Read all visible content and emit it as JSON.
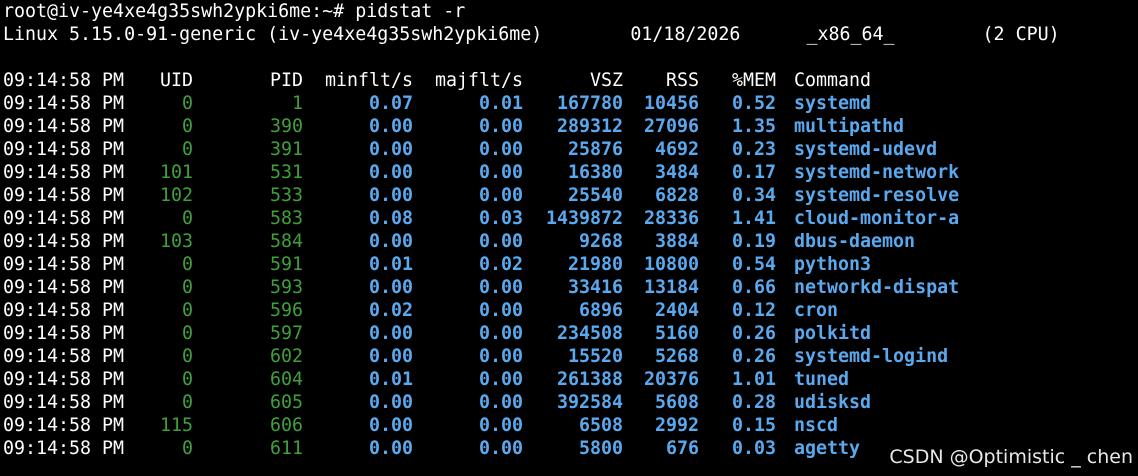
{
  "terminal": {
    "prompt_line": "root@iv-ye4xe4g35swh2ypki6me:~# pidstat -r",
    "info_line": "Linux 5.15.0-91-generic (iv-ye4xe4g35swh2ypki6me)        01/18/2026      _x86_64_        (2 CPU)",
    "headers": {
      "time": "09:14:58 PM",
      "uid": "UID",
      "pid": "PID",
      "minflt": "minflt/s",
      "majflt": "majflt/s",
      "vsz": "VSZ",
      "rss": "RSS",
      "mem": "%MEM",
      "command": "Command"
    },
    "rows": [
      {
        "time": "09:14:58 PM",
        "uid": "0",
        "pid": "1",
        "minflt": "0.07",
        "majflt": "0.01",
        "vsz": "167780",
        "rss": "10456",
        "mem": "0.52",
        "command": "systemd"
      },
      {
        "time": "09:14:58 PM",
        "uid": "0",
        "pid": "390",
        "minflt": "0.00",
        "majflt": "0.00",
        "vsz": "289312",
        "rss": "27096",
        "mem": "1.35",
        "command": "multipathd"
      },
      {
        "time": "09:14:58 PM",
        "uid": "0",
        "pid": "391",
        "minflt": "0.00",
        "majflt": "0.00",
        "vsz": "25876",
        "rss": "4692",
        "mem": "0.23",
        "command": "systemd-udevd"
      },
      {
        "time": "09:14:58 PM",
        "uid": "101",
        "pid": "531",
        "minflt": "0.00",
        "majflt": "0.00",
        "vsz": "16380",
        "rss": "3484",
        "mem": "0.17",
        "command": "systemd-network"
      },
      {
        "time": "09:14:58 PM",
        "uid": "102",
        "pid": "533",
        "minflt": "0.00",
        "majflt": "0.00",
        "vsz": "25540",
        "rss": "6828",
        "mem": "0.34",
        "command": "systemd-resolve"
      },
      {
        "time": "09:14:58 PM",
        "uid": "0",
        "pid": "583",
        "minflt": "0.08",
        "majflt": "0.03",
        "vsz": "1439872",
        "rss": "28336",
        "mem": "1.41",
        "command": "cloud-monitor-a"
      },
      {
        "time": "09:14:58 PM",
        "uid": "103",
        "pid": "584",
        "minflt": "0.00",
        "majflt": "0.00",
        "vsz": "9268",
        "rss": "3884",
        "mem": "0.19",
        "command": "dbus-daemon"
      },
      {
        "time": "09:14:58 PM",
        "uid": "0",
        "pid": "591",
        "minflt": "0.01",
        "majflt": "0.02",
        "vsz": "21980",
        "rss": "10800",
        "mem": "0.54",
        "command": "python3"
      },
      {
        "time": "09:14:58 PM",
        "uid": "0",
        "pid": "593",
        "minflt": "0.00",
        "majflt": "0.00",
        "vsz": "33416",
        "rss": "13184",
        "mem": "0.66",
        "command": "networkd-dispat"
      },
      {
        "time": "09:14:58 PM",
        "uid": "0",
        "pid": "596",
        "minflt": "0.02",
        "majflt": "0.00",
        "vsz": "6896",
        "rss": "2404",
        "mem": "0.12",
        "command": "cron"
      },
      {
        "time": "09:14:58 PM",
        "uid": "0",
        "pid": "597",
        "minflt": "0.00",
        "majflt": "0.00",
        "vsz": "234508",
        "rss": "5160",
        "mem": "0.26",
        "command": "polkitd"
      },
      {
        "time": "09:14:58 PM",
        "uid": "0",
        "pid": "602",
        "minflt": "0.00",
        "majflt": "0.00",
        "vsz": "15520",
        "rss": "5268",
        "mem": "0.26",
        "command": "systemd-logind"
      },
      {
        "time": "09:14:58 PM",
        "uid": "0",
        "pid": "604",
        "minflt": "0.01",
        "majflt": "0.00",
        "vsz": "261388",
        "rss": "20376",
        "mem": "1.01",
        "command": "tuned"
      },
      {
        "time": "09:14:58 PM",
        "uid": "0",
        "pid": "605",
        "minflt": "0.00",
        "majflt": "0.00",
        "vsz": "392584",
        "rss": "5608",
        "mem": "0.28",
        "command": "udisksd"
      },
      {
        "time": "09:14:58 PM",
        "uid": "115",
        "pid": "606",
        "minflt": "0.00",
        "majflt": "0.00",
        "vsz": "6508",
        "rss": "2992",
        "mem": "0.15",
        "command": "nscd"
      },
      {
        "time": "09:14:58 PM",
        "uid": "0",
        "pid": "611",
        "minflt": "0.00",
        "majflt": "0.00",
        "vsz": "5800",
        "rss": "676",
        "mem": "0.03",
        "command": "agetty"
      }
    ]
  },
  "watermark": "CSDN @Optimistic _ chen",
  "colors": {
    "background": "#000000",
    "text": "#ffffff",
    "id_green": "#3fa03a",
    "value_blue": "#5aa9ef"
  }
}
